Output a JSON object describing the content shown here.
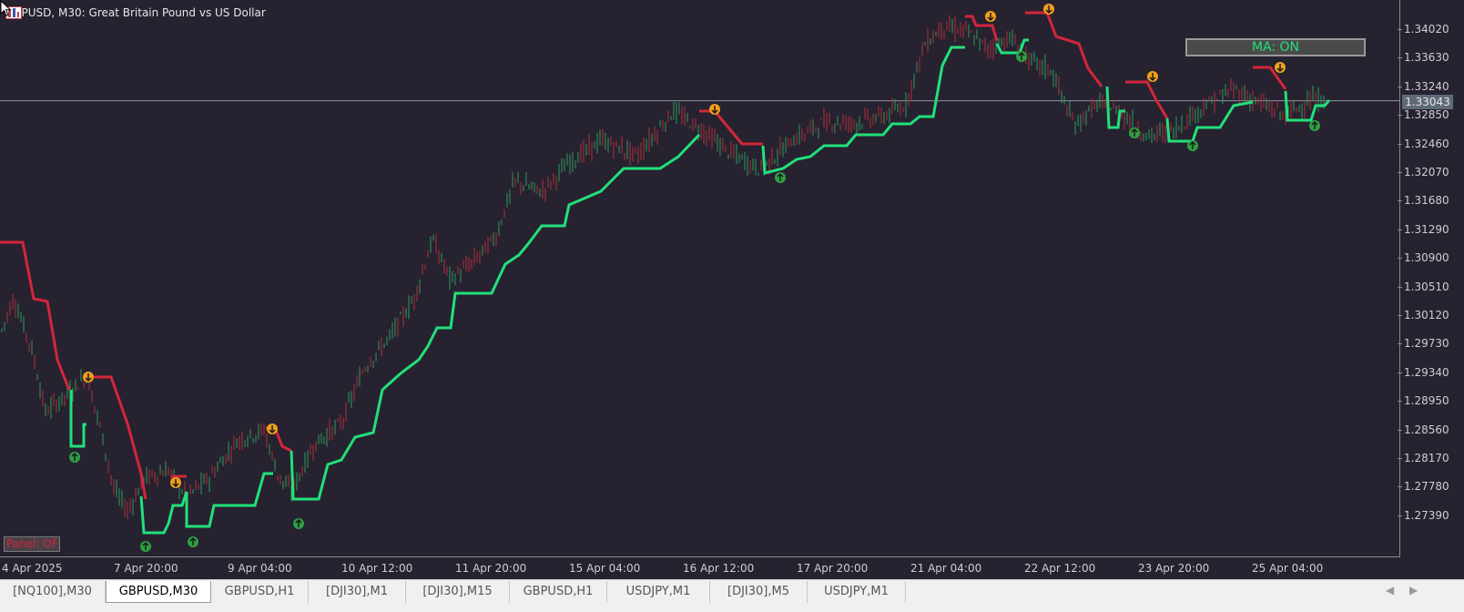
{
  "chart": {
    "title": "GBPUSD, M30:  Great Britain Pound vs US Dollar",
    "current_price": "1.33043",
    "price_ticks": [
      {
        "value": 1.3402,
        "label": "1.34020"
      },
      {
        "value": 1.3363,
        "label": "1.33630"
      },
      {
        "value": 1.3324,
        "label": "1.33240"
      },
      {
        "value": 1.3285,
        "label": "1.32850"
      },
      {
        "value": 1.3246,
        "label": "1.32460"
      },
      {
        "value": 1.3207,
        "label": "1.32070"
      },
      {
        "value": 1.3168,
        "label": "1.31680"
      },
      {
        "value": 1.3129,
        "label": "1.31290"
      },
      {
        "value": 1.309,
        "label": "1.30900"
      },
      {
        "value": 1.3051,
        "label": "1.30510"
      },
      {
        "value": 1.3012,
        "label": "1.30120"
      },
      {
        "value": 1.2973,
        "label": "1.29730"
      },
      {
        "value": 1.2934,
        "label": "1.29340"
      },
      {
        "value": 1.2895,
        "label": "1.28950"
      },
      {
        "value": 1.2856,
        "label": "1.28560"
      },
      {
        "value": 1.2817,
        "label": "1.28170"
      },
      {
        "value": 1.2778,
        "label": "1.27780"
      },
      {
        "value": 1.2739,
        "label": "1.27390"
      }
    ],
    "time_ticks": [
      "4 Apr 2025",
      "7 Apr 20:00",
      "9 Apr 04:00",
      "10 Apr 12:00",
      "11 Apr 20:00",
      "15 Apr 04:00",
      "16 Apr 12:00",
      "17 Apr 20:00",
      "21 Apr 04:00",
      "22 Apr 12:00",
      "23 Apr 20:00",
      "25 Apr 04:00"
    ],
    "ma_button": "MA: ON",
    "panel_button": "Panel: OF",
    "colors": {
      "background": "#262230",
      "up_line": "#22e07a",
      "down_line": "#d2263a",
      "bull_candle": "#2e9a5a",
      "bear_candle": "#b0303a",
      "arrow_up": "#2ea043",
      "arrow_down": "#f0a01a"
    }
  },
  "tabs": [
    {
      "label": "[NQ100],M30",
      "active": false
    },
    {
      "label": "GBPUSD,M30",
      "active": true
    },
    {
      "label": "GBPUSD,H1",
      "active": false
    },
    {
      "label": "[DJI30],M1",
      "active": false
    },
    {
      "label": "[DJI30],M15",
      "active": false
    },
    {
      "label": "GBPUSD,H1",
      "active": false
    },
    {
      "label": "USDJPY,M1",
      "active": false
    },
    {
      "label": "[DJI30],M5",
      "active": false
    },
    {
      "label": "USDJPY,M1",
      "active": false
    }
  ],
  "icons": {
    "title_icon_1": "chart-window-icon",
    "title_icon_2": "indicator-icon",
    "cursor": "mouse-cursor-icon",
    "scroll_left": "scroll-left-icon",
    "scroll_right": "scroll-right-icon"
  }
}
